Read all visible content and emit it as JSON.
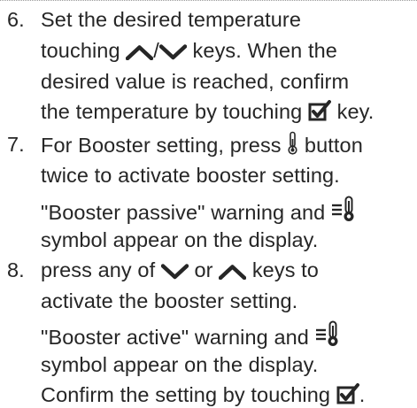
{
  "steps": [
    {
      "number": "6.",
      "lines": [
        [
          "Set the desired temperature"
        ],
        [
          "touching ",
          {
            "icon": "up-arrow-icon"
          },
          "/",
          {
            "icon": "down-arrow-icon"
          },
          " keys. When the"
        ],
        [
          "desired value is reached, confirm"
        ],
        [
          "the temperature by touching ",
          {
            "icon": "checkbox-confirm-icon"
          },
          " key."
        ]
      ]
    },
    {
      "number": "7.",
      "lines": [
        [
          "For Booster setting, press ",
          {
            "icon": "thermometer-icon"
          },
          " button"
        ],
        [
          "twice to activate booster setting."
        ],
        [
          "\"Booster passive\" warning and ",
          {
            "icon": "booster-thermometer-icon"
          }
        ],
        [
          "symbol appear on the display."
        ]
      ]
    },
    {
      "number": "8.",
      "lines": [
        [
          "press any of ",
          {
            "icon": "down-arrow-icon"
          },
          " or ",
          {
            "icon": "up-arrow-icon"
          },
          " keys to"
        ],
        [
          "activate the booster setting."
        ],
        [
          "\"Booster active\" warning and ",
          {
            "icon": "booster-thermometer-icon"
          }
        ],
        [
          "symbol appear on the display."
        ],
        [
          "Confirm the setting by touching ",
          {
            "icon": "checkbox-confirm-icon"
          },
          "."
        ]
      ]
    }
  ]
}
